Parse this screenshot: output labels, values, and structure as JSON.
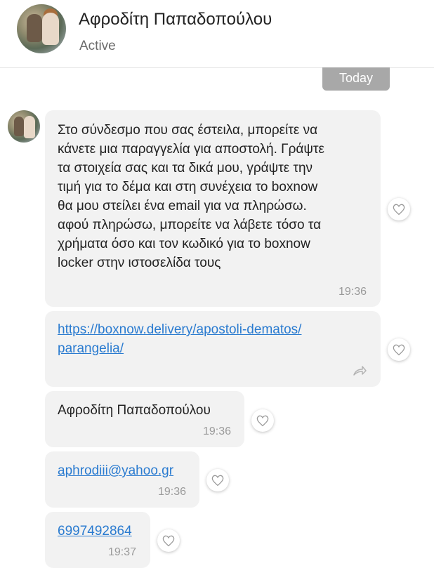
{
  "header": {
    "name": "Αφροδίτη Παπαδοπούλου",
    "status": "Active"
  },
  "date_divider": "Today",
  "messages": [
    {
      "lines": [
        "Στο σύνδεσμο που σας έστειλα, μπορείτε να",
        "κάνετε μια παραγγελία για αποστολή. Γράψτε",
        "τα στοιχεία σας και τα δικά μου, γράψτε την",
        "τιμή για το δέμα και στη συνέχεια το boxnow",
        "θα μου στείλει ένα email για να πληρώσω.",
        "αφού πληρώσω, μπορείτε να λάβετε τόσο τα",
        "χρήματα όσο και τον κωδικό για το boxnow",
        "locker στην ιστοσελίδα τους"
      ],
      "time": "19:36"
    },
    {
      "link_lines": [
        "https://boxnow.delivery/apostoli-dematos/",
        "parangelia/"
      ]
    },
    {
      "text": "Αφροδίτη Παπαδοπούλου",
      "time": "19:36"
    },
    {
      "link": "aphrodiii@yahoo.gr",
      "time": "19:36"
    },
    {
      "link": "6997492864",
      "time": "19:37"
    }
  ],
  "icons": {
    "heart": "heart-outline-icon",
    "forward": "forward-arrow-icon"
  }
}
